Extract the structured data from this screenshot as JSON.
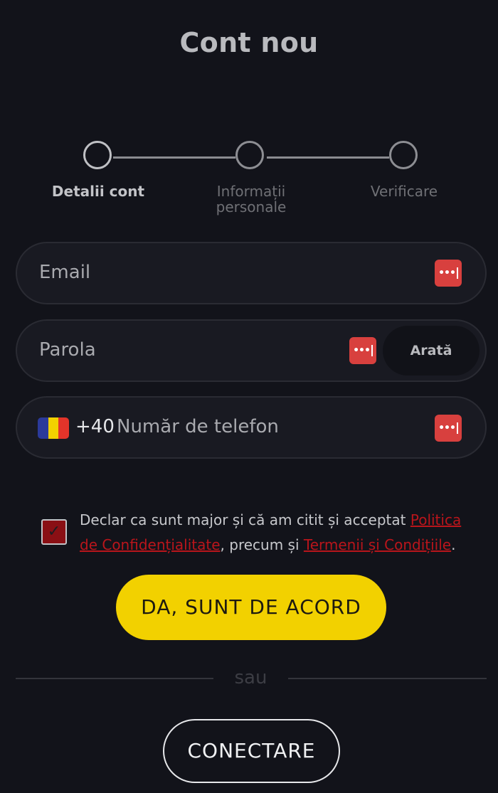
{
  "header": {
    "title": "Cont nou"
  },
  "stepper": {
    "steps": [
      {
        "label": "Detalii cont"
      },
      {
        "label": "Informații personale"
      },
      {
        "label": "Verificare"
      }
    ]
  },
  "form": {
    "email": {
      "placeholder": "Email"
    },
    "password": {
      "placeholder": "Parola",
      "show_label": "Arată"
    },
    "phone": {
      "country_code": "+40",
      "placeholder": "Număr de telefon",
      "flag_colors": [
        "#2b3a9a",
        "#f2d100",
        "#e3342a"
      ]
    },
    "password_manager_icon": "password-manager-icon"
  },
  "consent": {
    "checked": true,
    "text_before": "Declar ca sunt major și că am citit și acceptat ",
    "privacy_link": "Politica de Confidențialitate",
    "text_middle": ", precum și ",
    "terms_link": "Termenii și Condițiile",
    "text_after": "."
  },
  "actions": {
    "agree_label": "DA, SUNT DE ACORD",
    "divider_text": "sau",
    "login_label": "CONECTARE"
  },
  "colors": {
    "background": "#12131a",
    "accent_yellow": "#f2d100",
    "link_red": "#b9151b",
    "icon_red": "#d8403e"
  }
}
